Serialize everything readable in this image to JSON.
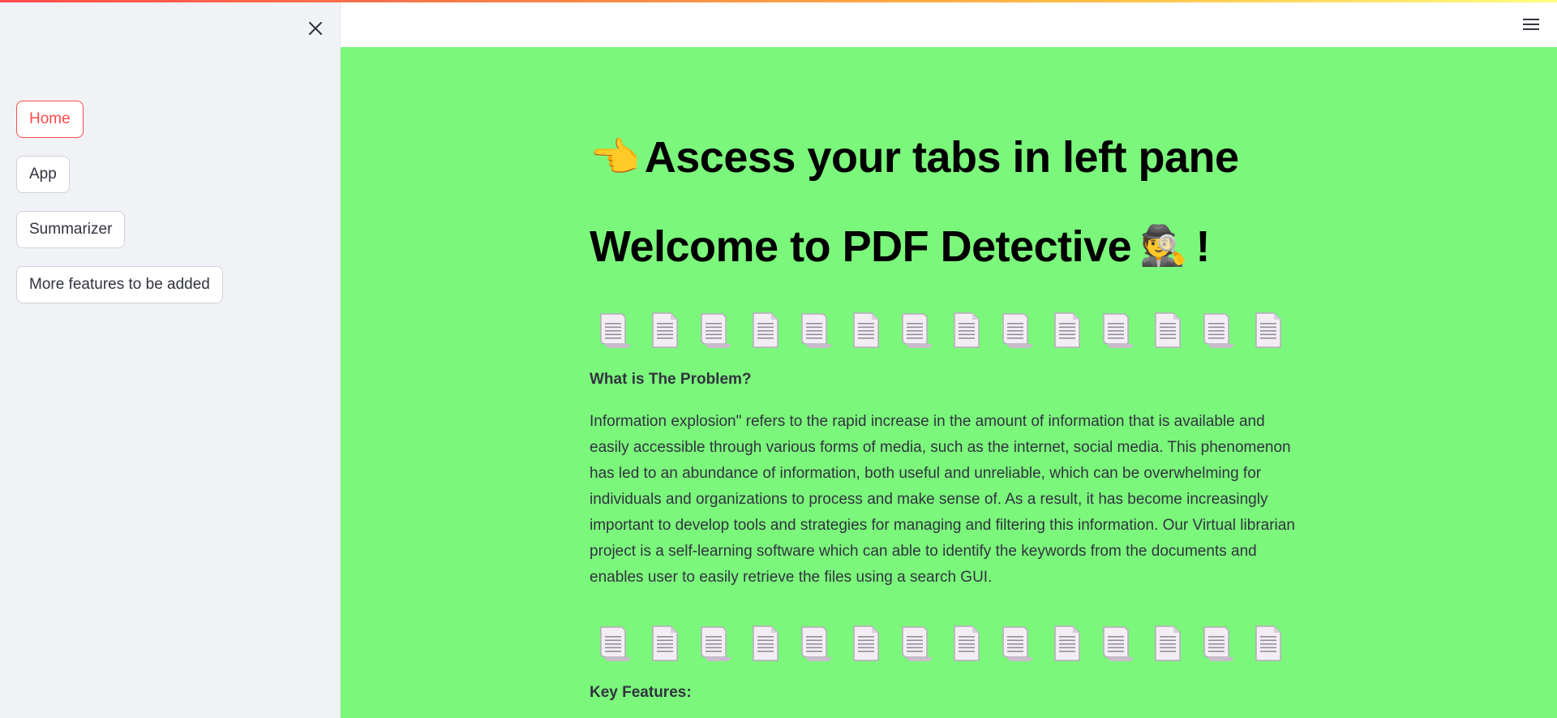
{
  "sidebar": {
    "close_icon": "close-icon",
    "nav": [
      {
        "label": "Home",
        "active": true
      },
      {
        "label": "App",
        "active": false
      },
      {
        "label": "Summarizer",
        "active": false
      },
      {
        "label": "More features to be added",
        "active": false
      }
    ]
  },
  "header": {
    "menu_icon": "hamburger-menu-icon"
  },
  "main": {
    "heading_pointer": "👈",
    "heading_1": "Ascess your tabs in left pane",
    "heading_2_text": "Welcome to PDF Detective",
    "heading_2_emoji": "🕵️",
    "heading_2_suffix": "!",
    "doc_icon_count": 14,
    "problem_title": "What is The Problem?",
    "problem_text": "Information explosion\" refers to the rapid increase in the amount of information that is available and easily accessible through various forms of media, such as the internet, social media. This phenomenon has led to an abundance of information, both useful and unreliable, which can be overwhelming for individuals and organizations to process and make sense of. As a result, it has become increasingly important to develop tools and strategies for managing and filtering this information. Our Virtual librarian project is a self-learning software which can able to identify the keywords from the documents and enables user to easily retrieve the files using a search GUI.",
    "features_title": "Key Features:"
  },
  "colors": {
    "main_bg": "#7bf77b",
    "sidebar_bg": "#f0f2f6",
    "accent": "#ff4b4b",
    "text": "#31333f"
  }
}
